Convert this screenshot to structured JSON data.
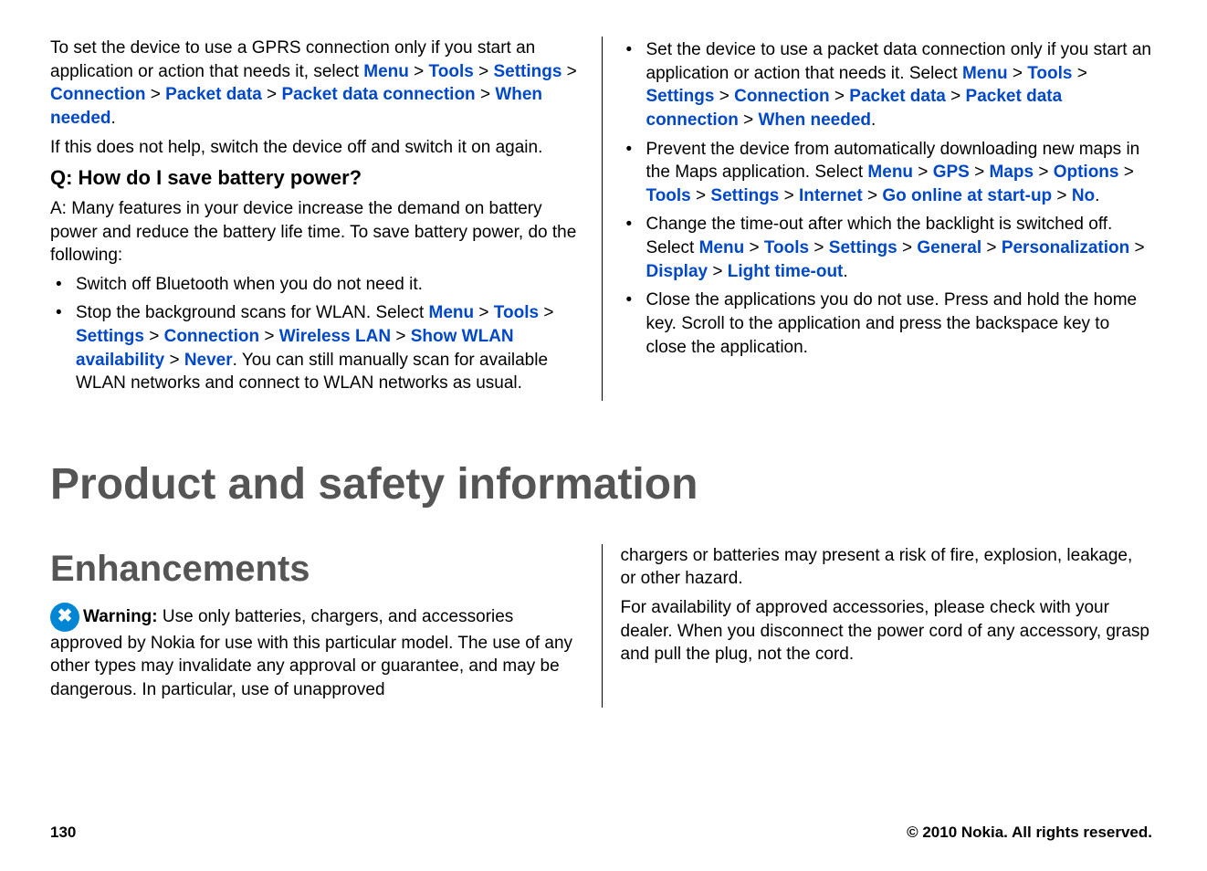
{
  "top": {
    "left": {
      "p1_pre": "To set the device to use a GPRS connection only if you start an application or action that needs it, select ",
      "path1": [
        "Menu",
        "Tools",
        "Settings",
        "Connection",
        "Packet data",
        "Packet data connection",
        "When needed"
      ],
      "p1_post": ".",
      "p2": "If this does not help, switch the device off and switch it on again.",
      "q": "Q: How do I save battery power?",
      "p3": "A: Many features in your device increase the demand on battery power and reduce the battery life time. To save battery power, do the following:",
      "li1": "Switch off Bluetooth when you do not need it.",
      "li2_pre": "Stop the background scans for WLAN. Select ",
      "li2_path": [
        "Menu",
        "Tools",
        "Settings",
        "Connection",
        "Wireless LAN",
        "Show WLAN availability",
        "Never"
      ],
      "li2_post": ". You can still manually scan for available WLAN networks and connect to WLAN networks as usual."
    },
    "right": {
      "li1_pre": "Set the device to use a packet data connection only if you start an application or action that needs it. Select ",
      "li1_path": [
        "Menu",
        "Tools",
        "Settings",
        "Connection",
        "Packet data",
        "Packet data connection",
        "When needed"
      ],
      "li1_post": ".",
      "li2_pre": "Prevent the device from automatically downloading new maps in the Maps application. Select ",
      "li2_path": [
        "Menu",
        "GPS",
        "Maps",
        "Options",
        "Tools",
        "Settings",
        "Internet",
        "Go online at start-up",
        "No"
      ],
      "li2_post": ".",
      "li3_pre": "Change the time-out after which the backlight is switched off. Select ",
      "li3_path": [
        "Menu",
        "Tools",
        "Settings",
        "General",
        "Personalization",
        "Display",
        "Light time-out"
      ],
      "li3_post": ".",
      "li4": "Close the applications you do not use. Press and hold the home key. Scroll to the application and press the backspace key to close the application."
    }
  },
  "h1": "Product and safety information",
  "h2": "Enhancements",
  "warn": {
    "label": "Warning:",
    "left": "  Use only batteries, chargers, and accessories approved by Nokia for use with this particular model. The use of any other types may invalidate any approval or guarantee, and may be dangerous. In particular, use of unapproved ",
    "right_p1": "chargers or batteries may present a risk of fire, explosion, leakage, or other hazard.",
    "right_p2": "For availability of approved accessories, please check with your dealer. When you disconnect the power cord of any accessory, grasp and pull the plug, not the cord."
  },
  "footer": {
    "page": "130",
    "copyright": "© 2010 Nokia. All rights reserved."
  },
  "sep": " > "
}
